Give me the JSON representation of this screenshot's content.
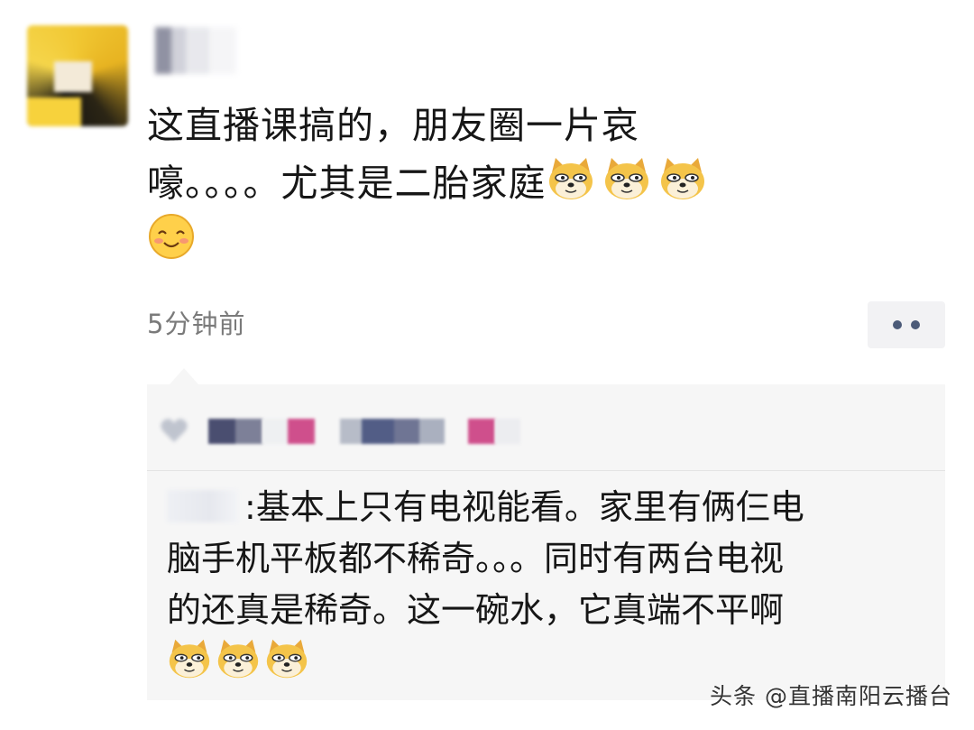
{
  "post": {
    "line1": "这直播课搞的，朋友圈一片哀",
    "line2": "嚎。。。。尤其是二胎家庭",
    "emoji_after_line2": [
      "doge-emoji",
      "doge-emoji",
      "doge-emoji"
    ],
    "emoji_line3": [
      "smile-emoji"
    ],
    "time": "5分钟前"
  },
  "comment": {
    "separator": ":",
    "line1": "基本上只有电视能看。家里有俩仨电",
    "line2": "脑手机平板都不稀奇。。。同时有两台电视",
    "line3": "的还真是稀奇。这一碗水，它真端不平啊",
    "emoji_line4": [
      "doge-emoji",
      "doge-emoji",
      "doge-emoji"
    ]
  },
  "watermark": "头条 @直播南阳云播台",
  "colors": {
    "likes_bg": "#f6f6f6",
    "more_dots": "#4b5a78",
    "time_text": "#7a7a7a",
    "doge_yellow": "#f4c44a"
  }
}
